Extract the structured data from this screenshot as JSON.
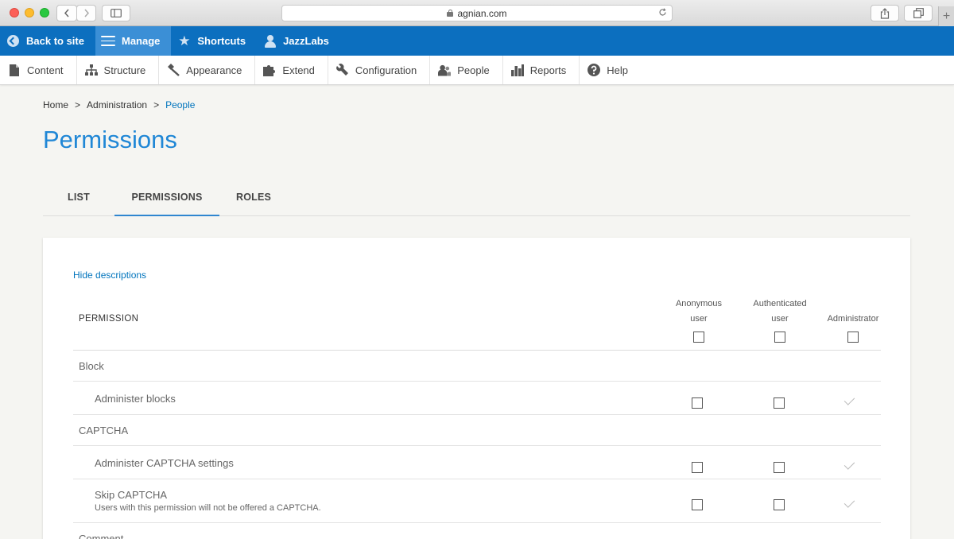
{
  "browser": {
    "url": "agnian.com",
    "reload_icon": "reload-icon",
    "plus": "+"
  },
  "toolbar": {
    "back_to_site": "Back to site",
    "manage": "Manage",
    "shortcuts": "Shortcuts",
    "user": "JazzLabs"
  },
  "admin_menu": {
    "items": [
      "Content",
      "Structure",
      "Appearance",
      "Extend",
      "Configuration",
      "People",
      "Reports",
      "Help"
    ]
  },
  "breadcrumb": {
    "home": "Home",
    "sep": ">",
    "administration": "Administration",
    "people": "People"
  },
  "page": {
    "title": "Permissions"
  },
  "tabs": [
    {
      "label": "LIST",
      "active": false
    },
    {
      "label": "PERMISSIONS",
      "active": true
    },
    {
      "label": "ROLES",
      "active": false
    }
  ],
  "table": {
    "hide_descriptions": "Hide descriptions",
    "permission_header": "PERMISSION",
    "roles": [
      {
        "line1": "Anonymous",
        "line2": "user"
      },
      {
        "line1": "Authenticated",
        "line2": "user"
      },
      {
        "line1": "Administrator",
        "line2": ""
      }
    ],
    "rows": [
      {
        "type": "group",
        "label": "Block"
      },
      {
        "type": "perm",
        "label": "Administer blocks",
        "description": ""
      },
      {
        "type": "group",
        "label": "CAPTCHA"
      },
      {
        "type": "perm",
        "label": "Administer CAPTCHA settings",
        "description": ""
      },
      {
        "type": "perm",
        "label": "Skip CAPTCHA",
        "description": "Users with this permission will not be offered a CAPTCHA."
      },
      {
        "type": "group",
        "label": "Comment"
      }
    ]
  },
  "colors": {
    "toolbar": "#0c6fbf",
    "toolbar_active": "#3b8fd6",
    "title": "#2087d6",
    "link": "#0074bd"
  }
}
